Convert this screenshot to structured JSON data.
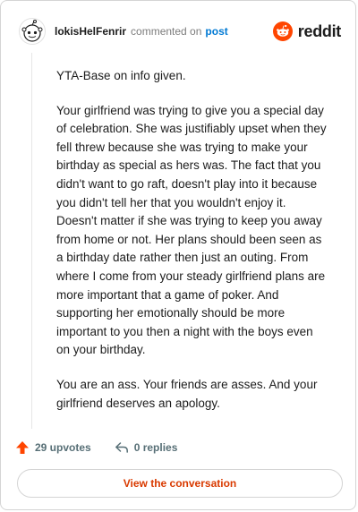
{
  "header": {
    "username": "lokisHelFenrir",
    "action_text": "commented on",
    "post_link": "post",
    "brand": "reddit"
  },
  "comment": {
    "paragraphs": [
      "YTA-Base on info given.",
      "Your girlfriend was trying to give you a special day of celebration. She was justifiably upset when they fell threw because she was trying to make your birthday as special as hers was. The fact that you didn't want to go raft, doesn't play into it because you didn't tell her that you wouldn't enjoy it. Doesn't matter if she was trying to keep you away from home or not. Her plans should been seen as a birthday date rather then just an outing. From where I come from your steady girlfriend plans are more important that a game of poker. And supporting her emotionally should be more important to you then a night with the boys even on your birthday.",
      "You are an ass. Your friends are asses. And your girlfriend deserves an apology."
    ]
  },
  "actions": {
    "upvotes": "29 upvotes",
    "replies": "0 replies",
    "view_button": "View the conversation"
  },
  "colors": {
    "brand_orange": "#ff4500",
    "link_blue": "#0079d3",
    "button_text": "#d93a00",
    "muted": "#576f76"
  },
  "icons": [
    "snoo-avatar-icon",
    "reddit-logo-icon",
    "upvote-arrow-icon",
    "reply-arrow-icon"
  ]
}
